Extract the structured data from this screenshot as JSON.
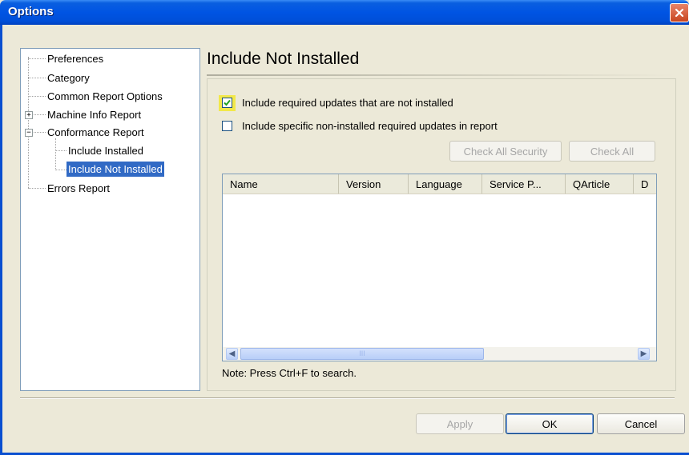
{
  "window": {
    "title": "Options"
  },
  "tree": {
    "items": [
      {
        "label": "Preferences"
      },
      {
        "label": "Category"
      },
      {
        "label": "Common Report Options"
      },
      {
        "label": "Machine Info Report",
        "expander": "+"
      },
      {
        "label": "Conformance Report",
        "expander": "−"
      },
      {
        "label": "Include Installed"
      },
      {
        "label": "Include Not Installed",
        "selected": true
      },
      {
        "label": "Errors Report"
      }
    ]
  },
  "panel": {
    "title": "Include Not Installed",
    "checkbox1": {
      "label": "Include required updates that are not installed",
      "checked": true
    },
    "checkbox2": {
      "label": "Include specific non-installed required updates in report",
      "checked": false
    },
    "check_all_security_label": "Check All Security",
    "check_all_label": "Check All",
    "list_columns": [
      "Name",
      "Version",
      "Language",
      "Service P...",
      "QArticle",
      "D"
    ],
    "scroll_thumb_grip": "III",
    "note": "Note: Press Ctrl+F to search."
  },
  "buttons": {
    "apply": "Apply",
    "ok": "OK",
    "cancel": "Cancel"
  },
  "colors": {
    "titlebar": "#0054E3",
    "selection": "#316AC5",
    "dialog_bg": "#ECE9D8"
  }
}
